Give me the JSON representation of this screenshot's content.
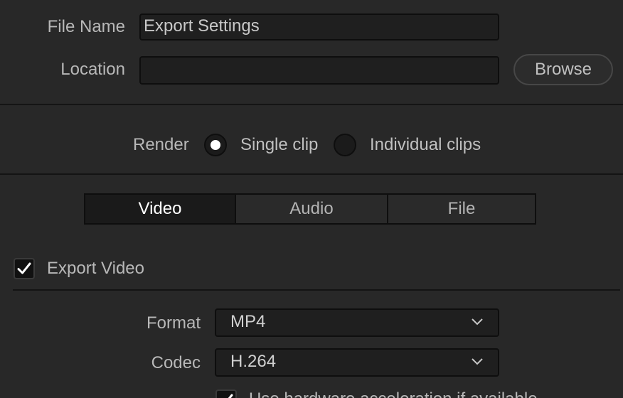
{
  "file_name": {
    "label": "File Name",
    "value": "Export Settings"
  },
  "location": {
    "label": "Location",
    "value": "",
    "browse_label": "Browse"
  },
  "render": {
    "label": "Render",
    "options": [
      {
        "label": "Single clip",
        "selected": true
      },
      {
        "label": "Individual clips",
        "selected": false
      }
    ]
  },
  "tabs": [
    {
      "label": "Video",
      "active": true
    },
    {
      "label": "Audio",
      "active": false
    },
    {
      "label": "File",
      "active": false
    }
  ],
  "export_video": {
    "label": "Export Video",
    "checked": true
  },
  "format": {
    "label": "Format",
    "value": "MP4"
  },
  "codec": {
    "label": "Codec",
    "value": "H.264"
  },
  "hardware_accel": {
    "label": "Use hardware acceleration if available",
    "checked": true
  },
  "colors": {
    "background": "#282828",
    "field": "#1f1f1f",
    "active_tab": "#1a1a1a",
    "text": "#c8c8c8"
  }
}
